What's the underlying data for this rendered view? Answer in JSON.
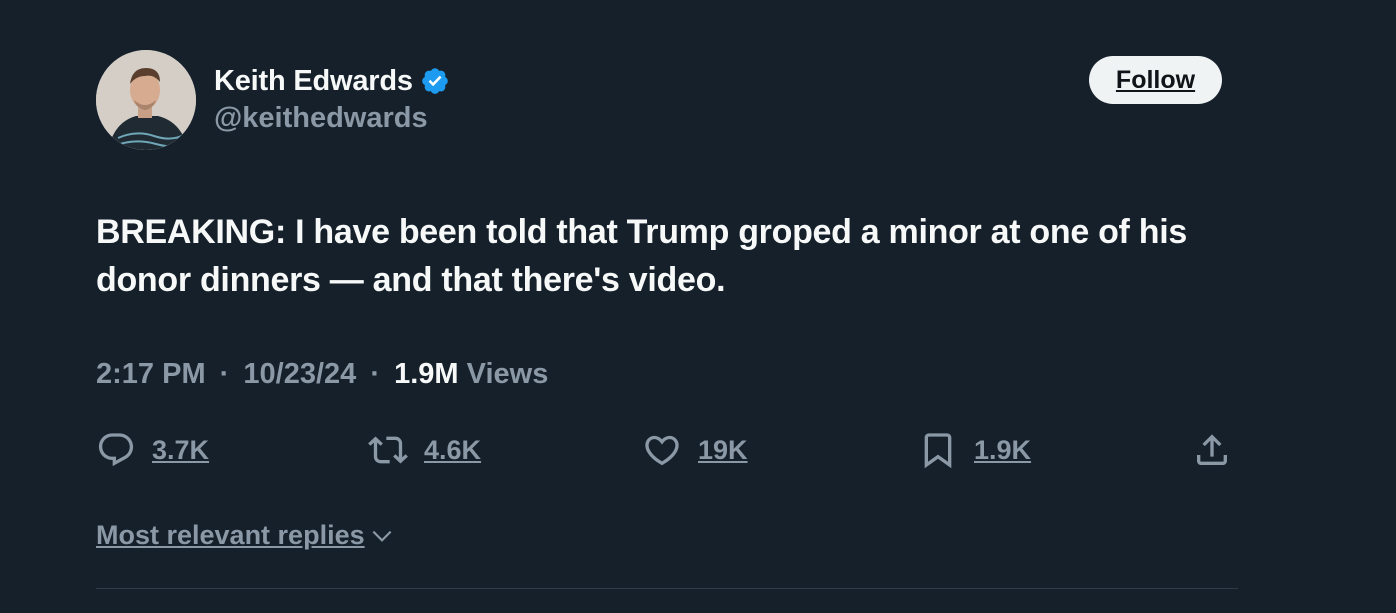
{
  "author": {
    "display_name": "Keith Edwards",
    "handle": "@keithedwards",
    "verified": true,
    "verified_icon": "verified-badge-icon",
    "avatar_icon": "avatar"
  },
  "follow_button": {
    "label": "Follow"
  },
  "tweet": {
    "text": "BREAKING: I have been told that Trump groped a minor at one of his donor dinners — and that there's video."
  },
  "meta": {
    "time": "2:17 PM",
    "separator": "·",
    "date": "10/23/24",
    "views_count": "1.9M",
    "views_label": "Views"
  },
  "actions": {
    "reply": {
      "icon": "reply-icon",
      "count": "3.7K"
    },
    "retweet": {
      "icon": "retweet-icon",
      "count": "4.6K"
    },
    "like": {
      "icon": "heart-icon",
      "count": "19K"
    },
    "bookmark": {
      "icon": "bookmark-icon",
      "count": "1.9K"
    },
    "share": {
      "icon": "share-icon"
    }
  },
  "replies_filter": {
    "label": "Most relevant replies",
    "icon": "chevron-down-icon"
  },
  "colors": {
    "background": "#15202b",
    "primary_text": "#f7f9f9",
    "secondary_text": "#8b98a5",
    "verified_blue": "#1d9bf0",
    "follow_bg": "#eff3f4",
    "divider": "#2f3b47"
  }
}
